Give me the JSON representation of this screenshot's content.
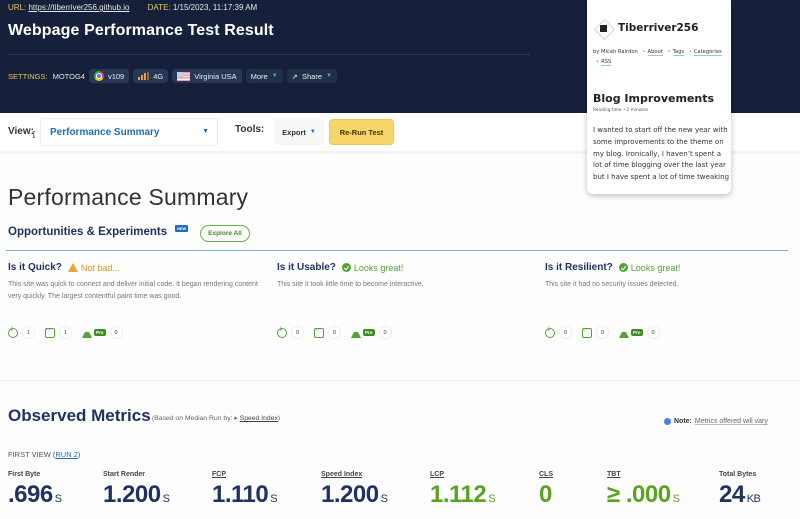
{
  "header": {
    "url_label": "URL:",
    "url": "https://tiberriver256.github.io",
    "date_label": "DATE:",
    "date": "1/15/2023, 11:17:39 AM",
    "title": "Webpage Performance Test Result",
    "settings_label": "SETTINGS:",
    "device": "MOTOG4",
    "browser": "v109",
    "connection": "4G",
    "location": "Virginia USA",
    "more_label": "More",
    "share_label": "Share"
  },
  "popup": {
    "site_name": "Tiberriver256",
    "byline": "by Micah Rairdon",
    "links": [
      "About",
      "Tags",
      "Categories",
      "RSS"
    ],
    "post_title": "Blog Improvements",
    "reading_time": "Reading time ~2 minutes",
    "excerpt": "I wanted to start off the new year with some improvements to the theme on my blog. Ironically, I haven’t spent a lot of time blogging over the last year but I have spent a lot of time tweaking"
  },
  "toolbar": {
    "view_label": "View:",
    "view_value": "Performance Summary",
    "tools_label": "Tools:",
    "export_label": "Export",
    "rerun_label": "Re-Run Test"
  },
  "summary": {
    "title": "Performance Summary",
    "opportunities_title": "Opportunities & Experiments",
    "new_badge": "NEW",
    "explore_all": "Explore All",
    "pro_label": "Pro",
    "cards": [
      {
        "question": "Is it Quick?",
        "status": "Not bad...",
        "status_type": "warning",
        "description": "This site was quick to connect and deliver initial code. It began rendering content very quickly. The largest contentful paint time was good.",
        "counts": {
          "tips": "1",
          "code": "1",
          "experiments": "0"
        }
      },
      {
        "question": "Is it Usable?",
        "status": "Looks great!",
        "status_type": "good",
        "description": "This site it took little time to become interactive.",
        "counts": {
          "tips": "0",
          "code": "0",
          "experiments": "0"
        }
      },
      {
        "question": "Is it Resilient?",
        "status": "Looks great!",
        "status_type": "good",
        "description": "This site it had no security issues detected.",
        "counts": {
          "tips": "0",
          "code": "0",
          "experiments": "0"
        }
      }
    ]
  },
  "observed": {
    "title": "Observed Metrics",
    "subtitle_prefix": "(Based on Median Run by: ▸",
    "subtitle_link": "Speed Index",
    "subtitle_suffix": ")",
    "note_label": "Note:",
    "note_text": "Metrics offered will vary",
    "first_view_prefix": "FIRST VIEW (",
    "first_view_run": "RUN 2",
    "first_view_suffix": ")",
    "metrics": [
      {
        "label": "First Byte",
        "value": ".696",
        "unit": "S"
      },
      {
        "label": "Start Render",
        "value": "1.200",
        "unit": "S"
      },
      {
        "label": "FCP",
        "value": "1.110",
        "unit": "S"
      },
      {
        "label": "Speed Index",
        "value": "1.200",
        "unit": "S"
      },
      {
        "label": "LCP",
        "value": "1.112",
        "unit": "S"
      },
      {
        "label": "CLS",
        "value": "0",
        "unit": ""
      },
      {
        "label": "TBT",
        "value": "≥ .000",
        "unit": "S"
      },
      {
        "label": "Total Bytes",
        "value": "24",
        "unit": "KB"
      }
    ]
  },
  "colors": {
    "header_bg": "#16203a",
    "accent_blue": "#1f6bbf",
    "good_green": "#5aa222",
    "warning_orange": "#e0922b",
    "rerun_yellow": "#f7d56b",
    "navy_text": "#1f3361"
  }
}
